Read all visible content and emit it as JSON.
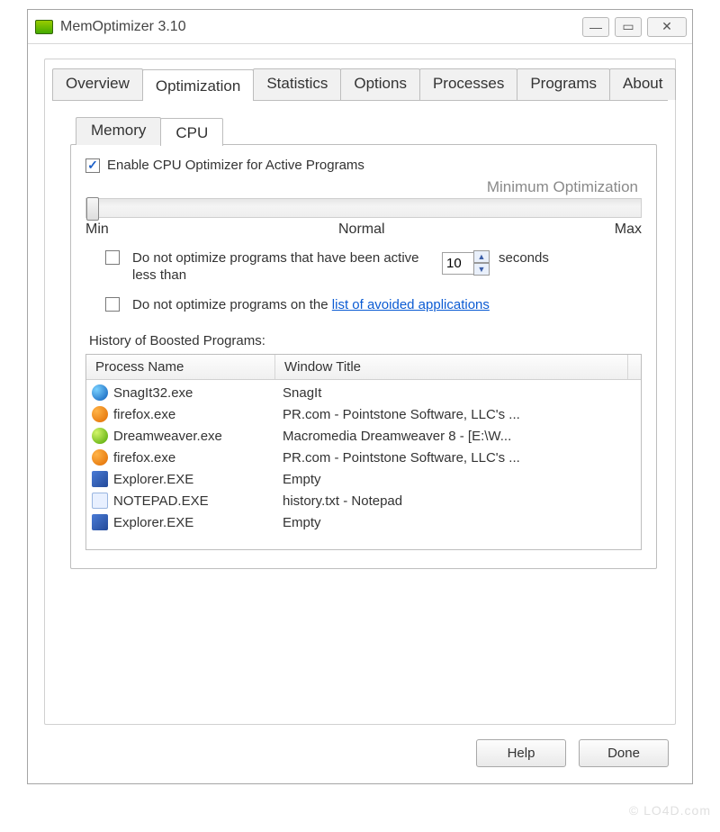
{
  "window": {
    "title": "MemOptimizer 3.10"
  },
  "tabs": [
    {
      "label": "Overview"
    },
    {
      "label": "Optimization",
      "selected": true
    },
    {
      "label": "Statistics"
    },
    {
      "label": "Options"
    },
    {
      "label": "Processes"
    },
    {
      "label": "Programs"
    },
    {
      "label": "About"
    }
  ],
  "subtabs": [
    {
      "label": "Memory"
    },
    {
      "label": "CPU",
      "selected": true
    }
  ],
  "cpu": {
    "enable_label": "Enable CPU Optimizer for Active Programs",
    "enable_checked": true,
    "level_text": "Minimum Optimization",
    "slider": {
      "min_label": "Min",
      "mid_label": "Normal",
      "max_label": "Max",
      "value": 0
    },
    "opt_active": {
      "checked": false,
      "label": "Do not optimize programs that have been active less than",
      "seconds_value": "10",
      "seconds_unit": "seconds"
    },
    "opt_avoid": {
      "checked": false,
      "prefix": "Do not optimize programs on the ",
      "link": "list of avoided applications"
    },
    "history_label": "History of Boosted Programs:",
    "columns": {
      "c1": "Process Name",
      "c2": "Window Title"
    },
    "rows": [
      {
        "icon": "snagit",
        "process": "SnagIt32.exe",
        "title": "SnagIt"
      },
      {
        "icon": "firefox",
        "process": "firefox.exe",
        "title": "PR.com - Pointstone Software, LLC's ..."
      },
      {
        "icon": "dream",
        "process": "Dreamweaver.exe",
        "title": "Macromedia Dreamweaver 8 - [E:\\W..."
      },
      {
        "icon": "firefox",
        "process": "firefox.exe",
        "title": "PR.com - Pointstone Software, LLC's ..."
      },
      {
        "icon": "explorer",
        "process": "Explorer.EXE",
        "title": "Empty"
      },
      {
        "icon": "notepad",
        "process": "NOTEPAD.EXE",
        "title": "history.txt - Notepad"
      },
      {
        "icon": "explorer",
        "process": "Explorer.EXE",
        "title": "Empty"
      }
    ]
  },
  "buttons": {
    "help": "Help",
    "done": "Done"
  },
  "watermark": "© LO4D.com"
}
